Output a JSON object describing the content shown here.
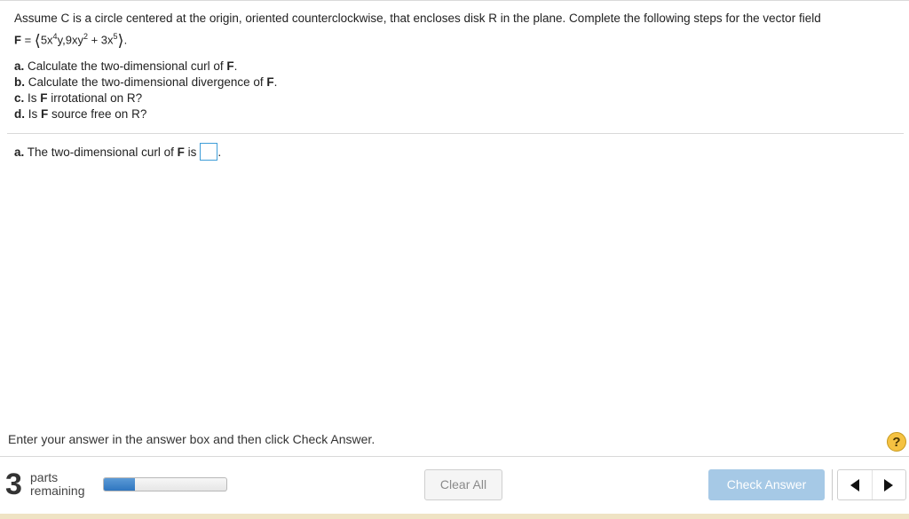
{
  "question": {
    "intro": "Assume C is a circle centered at the origin, oriented counterclockwise, that encloses disk R in the plane. Complete the following steps for the vector field",
    "formula": {
      "F": "F",
      "eq": " = ",
      "open": "⟨",
      "t1": "5x",
      "t1_exp": "4",
      "t1_rest": "y,9xy",
      "t2_exp": "2",
      "t3": " + 3x",
      "t3_exp": "5",
      "close": "⟩",
      "end": "."
    },
    "steps": [
      {
        "letter": "a.",
        "pre": " Calculate the two-dimensional curl of ",
        "bold": "F",
        "post": "."
      },
      {
        "letter": "b.",
        "pre": " Calculate the two-dimensional divergence of ",
        "bold": "F",
        "post": "."
      },
      {
        "letter": "c.",
        "pre": " Is ",
        "bold": "F",
        "post": " irrotational on R?"
      },
      {
        "letter": "d.",
        "pre": " Is ",
        "bold": "F",
        "post": " source free on R?"
      }
    ]
  },
  "answer": {
    "letter": "a.",
    "pre": " The two-dimensional curl of ",
    "bold": "F",
    "post": " is",
    "end": "."
  },
  "footer": {
    "instruction": "Enter your answer in the answer box and then click Check Answer.",
    "help": "?",
    "parts_count": "3",
    "parts_line1": "parts",
    "parts_line2": "remaining",
    "progress_fraction": 0.25,
    "clear_label": "Clear All",
    "check_label": "Check Answer"
  },
  "icons": {
    "help": "help-icon",
    "prev": "prev-arrow-icon",
    "next": "next-arrow-icon"
  },
  "colors": {
    "accent": "#3f9ed8",
    "check_button": "#a6c9e6",
    "progress_fill": "#2f76c0",
    "help_icon": "#f5c242"
  }
}
